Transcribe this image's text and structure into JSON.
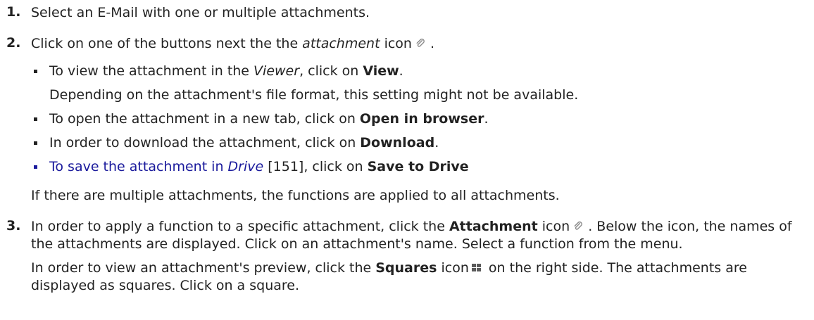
{
  "steps": [
    {
      "number": "1.",
      "text": "Select an E-Mail with one or multiple attachments."
    },
    {
      "number": "2.",
      "text_before": "Click on one of the buttons next the the ",
      "text_em": "attachment",
      "text_after": " icon",
      "text_end": " .",
      "items": [
        {
          "pre": "To view the attachment in the ",
          "em": "Viewer",
          "mid": ", click on ",
          "bold": "View",
          "end": ".",
          "note": "Depending on the attachment's file format, this setting might not be available."
        },
        {
          "pre": "To open the attachment in a new tab, click on ",
          "bold": "Open in browser",
          "end": "."
        },
        {
          "pre": "In order to download the attachment, click on ",
          "bold": "Download",
          "end": "."
        },
        {
          "link_pre": "To save the attachment in ",
          "link_em": "Drive",
          "link_ref": " [151]",
          "mid": ", click on ",
          "bold": "Save to Drive"
        }
      ],
      "after_note": "If there are multiple attachments, the functions are applied to all attachments."
    },
    {
      "number": "3.",
      "p1_before": "In order to apply a function to a specific attachment, click the ",
      "p1_bold": "Attachment",
      "p1_after_bold": " icon",
      "p1_rest": " . Below the icon, the names of the attachments are displayed. Click on an attachment's name. Select a function from the menu.",
      "p2_before": "In order to view an attachment's preview, click the ",
      "p2_bold": "Squares",
      "p2_after_bold": " icon",
      "p2_rest": " on the right side. The attachments are displayed as squares. Click on a square."
    }
  ],
  "icons": {
    "attachment": "paperclip-icon",
    "squares": "squares-icon",
    "icon_color": "#8a8a8a",
    "squares_color": "#5a5a5a",
    "link_color": "#1a1a9c"
  }
}
